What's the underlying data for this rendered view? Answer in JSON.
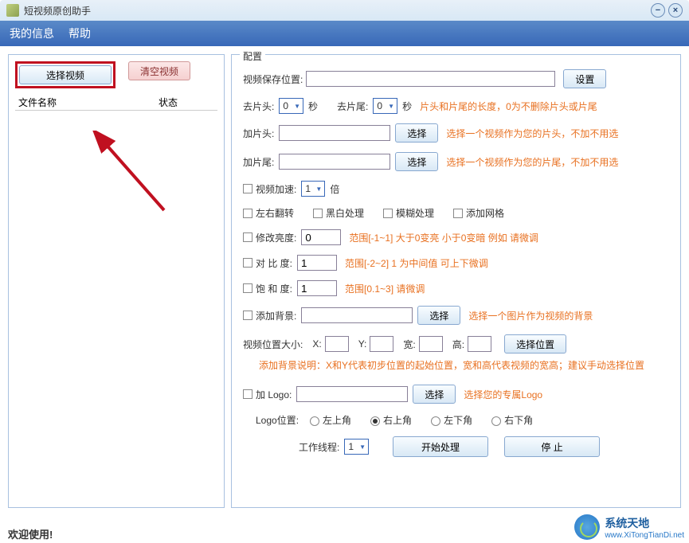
{
  "titlebar": {
    "title": "短视频原创助手"
  },
  "menu": {
    "my_info": "我的信息",
    "help": "帮助"
  },
  "left": {
    "select_video": "选择视频",
    "clear_video": "清空视频",
    "col_filename": "文件名称",
    "col_status": "状态"
  },
  "config": {
    "title": "配置",
    "save_path_label": "视频保存位置:",
    "set_button": "设置",
    "trim_head_label": "去片头:",
    "trim_head_value": "0",
    "seconds": "秒",
    "trim_tail_label": "去片尾:",
    "trim_tail_value": "0",
    "trim_hint": "片头和片尾的长度，0为不删除片头或片尾",
    "add_head_label": "加片头:",
    "choose": "选择",
    "add_head_hint": "选择一个视频作为您的片头，不加不用选",
    "add_tail_label": "加片尾:",
    "add_tail_hint": "选择一个视频作为您的片尾，不加不用选",
    "speed_label": "视频加速:",
    "speed_value": "1",
    "speed_unit": "倍",
    "flip_h": "左右翻转",
    "bw": "黑白处理",
    "blur": "模糊处理",
    "grid": "添加网格",
    "brightness_label": "修改亮度:",
    "brightness_value": "0",
    "brightness_hint": "范围[-1~1]   大于0变亮 小于0变暗  例如 请微调",
    "contrast_label": "对 比  度:",
    "contrast_value": "1",
    "contrast_hint": "范围[-2~2]  1 为中间值  可上下微调",
    "saturation_label": "饱 和  度:",
    "saturation_value": "1",
    "saturation_hint": "范围[0.1~3]   请微调",
    "bg_label": "添加背景:",
    "bg_hint": "选择一个图片作为视频的背景",
    "pos_label": "视频位置大小:",
    "pos_x": "X:",
    "pos_y": "Y:",
    "pos_w": "宽:",
    "pos_h": "高:",
    "choose_pos": "选择位置",
    "bg_note": "添加背景说明：X和Y代表初步位置的起始位置，宽和高代表视频的宽高；建议手动选择位置",
    "logo_label": "加 Logo:",
    "logo_hint": "选择您的专属Logo",
    "logo_pos_label": "Logo位置:",
    "logo_tl": "左上角",
    "logo_tr": "右上角",
    "logo_bl": "左下角",
    "logo_br": "右下角",
    "threads_label": "工作线程:",
    "threads_value": "1",
    "start": "开始处理",
    "stop": "停   止"
  },
  "statusbar": {
    "welcome": "欢迎使用!"
  },
  "watermark": {
    "cn": "系统天地",
    "url": "www.XiTongTianDi.net"
  }
}
